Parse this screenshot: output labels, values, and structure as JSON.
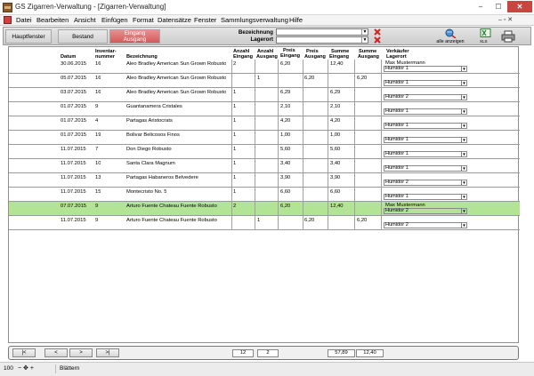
{
  "window": {
    "title": "GS Zigarren-Verwaltung - [Zigarren-Verwaltung]",
    "min_glyph": "–",
    "max_glyph": "☐",
    "close_glyph": "✕"
  },
  "menu": {
    "items": [
      "Datei",
      "Bearbeiten",
      "Ansicht",
      "Einfügen",
      "Format",
      "Datensätze",
      "Fenster",
      "Sammlungsverwaltung",
      "Hilfe"
    ],
    "mdi_glyphs": "– ▫ ✕"
  },
  "toolbar": {
    "btn_main": "Hauptfenster",
    "btn_stock": "Bestand",
    "btn_in_1": "Eingang",
    "btn_in_2": "Ausgang",
    "label_designation": "Bezeichnung",
    "label_storage": "Lagerort",
    "show_all": "alle anzeigen",
    "xls": "XLS",
    "accent": "#d25a5a",
    "icons": [
      "clear-x-icon",
      "search-globe-icon",
      "excel-icon",
      "printer-icon"
    ]
  },
  "table": {
    "headers": {
      "date": "Datum",
      "inv_1": "Inventar-",
      "inv_2": "nummer",
      "name": "Bezeichnung",
      "qin_1": "Anzahl",
      "qin_2": "Eingang",
      "qout_1": "Anzahl",
      "qout_2": "Ausgang",
      "pin_1": "Preis",
      "pin_2": "Eingang",
      "pout_1": "Preis",
      "pout_2": "Ausgang",
      "sin_1": "Summe",
      "sin_2": "Eingang",
      "sout_1": "Summe",
      "sout_2": "Ausgang",
      "seller_1": "Verkäufer",
      "seller_2": "Lagerort"
    },
    "rows": [
      {
        "date": "30.06.2015",
        "inv": "16",
        "name": "Aleo Bradley American Sun Grown Robusto",
        "qin": "2",
        "qout": "",
        "pin": "6,20",
        "pout": "",
        "sin": "12,40",
        "sout": "",
        "seller": "Max Mustermann",
        "storage": "Humidor 1",
        "selected": false
      },
      {
        "date": "05.07.2015",
        "inv": "16",
        "name": "Aleo Bradley American Sun Grown Robusto",
        "qin": "",
        "qout": "1",
        "pin": "",
        "pout": "6,20",
        "sin": "",
        "sout": "6,20",
        "seller": "",
        "storage": "Humidor 1",
        "selected": false
      },
      {
        "date": "03.07.2015",
        "inv": "16",
        "name": "Aleo Bradley American Sun Grown Robusto",
        "qin": "1",
        "qout": "",
        "pin": "6,29",
        "pout": "",
        "sin": "6,29",
        "sout": "",
        "seller": "",
        "storage": "Humidor 2",
        "selected": false
      },
      {
        "date": "01.07.2015",
        "inv": "9",
        "name": "Guantanamera Cristales",
        "qin": "1",
        "qout": "",
        "pin": "2,10",
        "pout": "",
        "sin": "2,10",
        "sout": "",
        "seller": "",
        "storage": "Humidor 1",
        "selected": false
      },
      {
        "date": "01.07.2015",
        "inv": "4",
        "name": "Partagas Aristocrats",
        "qin": "1",
        "qout": "",
        "pin": "4,20",
        "pout": "",
        "sin": "4,20",
        "sout": "",
        "seller": "",
        "storage": "Humidor 1",
        "selected": false
      },
      {
        "date": "01.07.2015",
        "inv": "19",
        "name": "Bolivar Belicosos Finos",
        "qin": "1",
        "qout": "",
        "pin": "1,00",
        "pout": "",
        "sin": "1,00",
        "sout": "",
        "seller": "",
        "storage": "Humidor 1",
        "selected": false
      },
      {
        "date": "11.07.2015",
        "inv": "7",
        "name": "Don Diego Robusto",
        "qin": "1",
        "qout": "",
        "pin": "5,60",
        "pout": "",
        "sin": "5,60",
        "sout": "",
        "seller": "",
        "storage": "Humidor 1",
        "selected": false
      },
      {
        "date": "11.07.2015",
        "inv": "10",
        "name": "Santa Clara Magnum",
        "qin": "1",
        "qout": "",
        "pin": "3,40",
        "pout": "",
        "sin": "3,40",
        "sout": "",
        "seller": "",
        "storage": "Humidor 1",
        "selected": false
      },
      {
        "date": "11.07.2015",
        "inv": "13",
        "name": "Partagas Habaneros Belvedere",
        "qin": "1",
        "qout": "",
        "pin": "3,90",
        "pout": "",
        "sin": "3,90",
        "sout": "",
        "seller": "",
        "storage": "Humidor 2",
        "selected": false
      },
      {
        "date": "11.07.2015",
        "inv": "15",
        "name": "Montecristo No. 5",
        "qin": "1",
        "qout": "",
        "pin": "6,60",
        "pout": "",
        "sin": "6,60",
        "sout": "",
        "seller": "",
        "storage": "Humidor 1",
        "selected": false
      },
      {
        "date": "07.07.2015",
        "inv": "9",
        "name": "Arturo Fuente Chateau Fuente Robusto",
        "qin": "2",
        "qout": "",
        "pin": "6,20",
        "pout": "",
        "sin": "12,40",
        "sout": "",
        "seller": "Max Mustermann",
        "storage": "Humidor 2",
        "selected": true
      },
      {
        "date": "11.07.2015",
        "inv": "9",
        "name": "Arturo Fuente Chateau Fuente Robusto",
        "qin": "",
        "qout": "1",
        "pin": "",
        "pout": "6,20",
        "sin": "",
        "sout": "6,20",
        "seller": "",
        "storage": "Humidor 2",
        "selected": false
      }
    ],
    "selected_color": "#b3e394"
  },
  "footer": {
    "nav_first": "|<",
    "nav_prev": "<",
    "nav_next": ">",
    "nav_last": ">|",
    "sum_qin": "12",
    "sum_qout": "2",
    "sum_in": "57,89",
    "sum_out": "12,40"
  },
  "status": {
    "zoom": "100",
    "zoom_minus": "−",
    "zoom_plus": "+",
    "mode": "Blättern"
  }
}
